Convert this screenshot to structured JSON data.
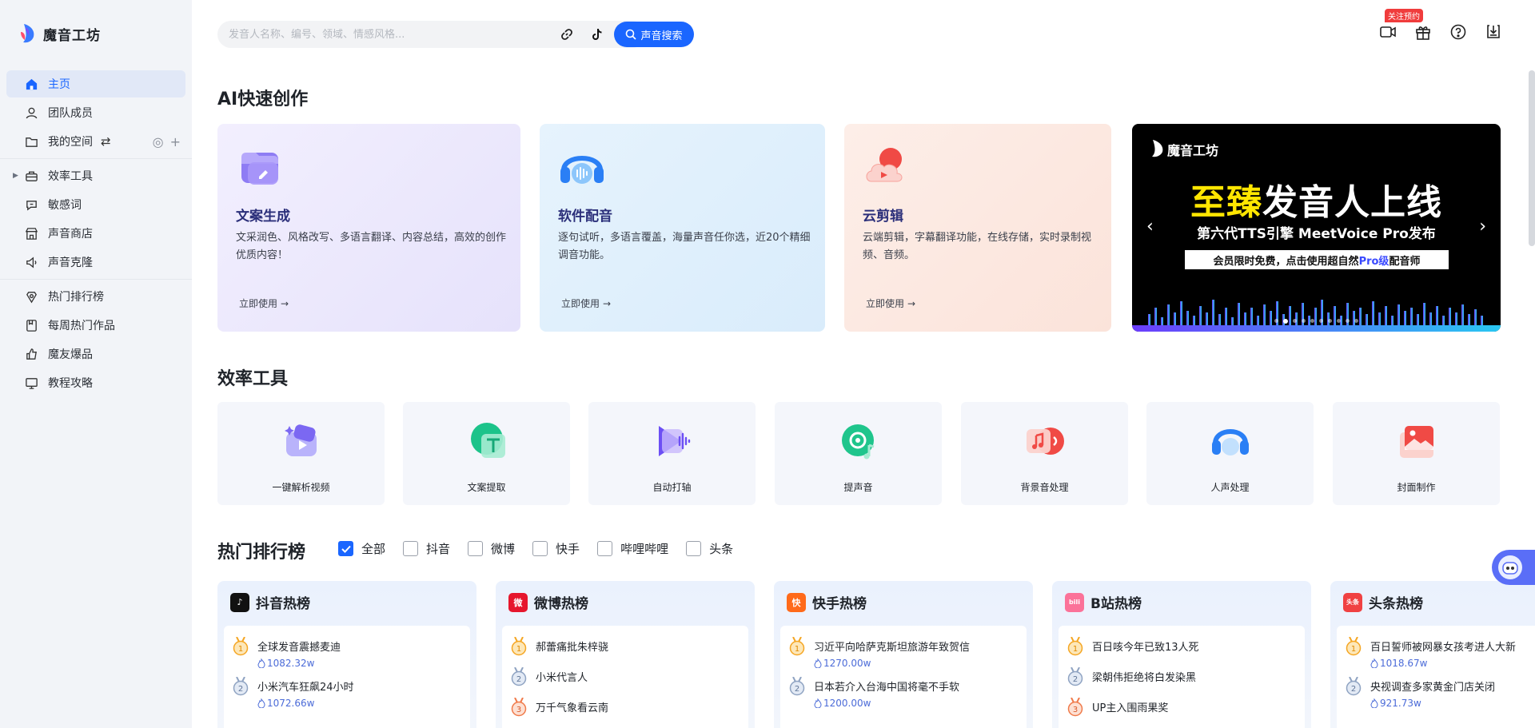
{
  "brand": {
    "name": "魔音工坊"
  },
  "sidebar": {
    "items": [
      {
        "label": "主页",
        "icon": "home-icon",
        "active": true
      },
      {
        "label": "团队成员",
        "icon": "user-icon"
      },
      {
        "label": "我的空间",
        "icon": "folder-icon"
      },
      {
        "label": "效率工具",
        "icon": "toolbox-icon"
      },
      {
        "label": "敏感词",
        "icon": "sensitive-icon"
      },
      {
        "label": "声音商店",
        "icon": "store-icon"
      },
      {
        "label": "声音克隆",
        "icon": "clone-icon"
      },
      {
        "label": "热门排行榜",
        "icon": "rank-icon"
      },
      {
        "label": "每周热门作品",
        "icon": "weekly-icon"
      },
      {
        "label": "魔友爆品",
        "icon": "thumbs-up-icon"
      },
      {
        "label": "教程攻略",
        "icon": "monitor-icon"
      }
    ],
    "swap_glyph": "⇄"
  },
  "search": {
    "placeholder": "发音人名称、编号、领域、情感风格...",
    "button_label": "声音搜索"
  },
  "topbar": {
    "badge": "关注预约"
  },
  "ai_section": {
    "title": "AI快速创作",
    "cards": [
      {
        "title": "文案生成",
        "desc": "文采润色、风格改写、多语言翻译、内容总结，高效的创作优质内容！",
        "action": "立即使用"
      },
      {
        "title": "软件配音",
        "desc": "逐句试听，多语言覆盖，海量声音任你选，近20个精细调音功能。",
        "action": "立即使用"
      },
      {
        "title": "云剪辑",
        "desc": "云端剪辑，字幕翻译功能，在线存储，实时录制视频、音频。",
        "action": "立即使用"
      }
    ],
    "banner": {
      "brand": "魔音工坊",
      "headline_highlight": "至臻",
      "headline_rest": "发音人上线",
      "subline": "第六代TTS引擎 MeetVoice Pro发布",
      "pill_pre": "会员限时免费，点击使用超自然",
      "pill_pro": "Pro级",
      "pill_post": "配音师"
    }
  },
  "tools_section": {
    "title": "效率工具",
    "items": [
      {
        "label": "一键解析视频"
      },
      {
        "label": "文案提取"
      },
      {
        "label": "自动打轴"
      },
      {
        "label": "提声音"
      },
      {
        "label": "背景音处理"
      },
      {
        "label": "人声处理"
      },
      {
        "label": "封面制作"
      }
    ]
  },
  "rank_section": {
    "title": "热门排行榜",
    "filters": [
      {
        "label": "全部",
        "checked": true
      },
      {
        "label": "抖音",
        "checked": false
      },
      {
        "label": "微博",
        "checked": false
      },
      {
        "label": "快手",
        "checked": false
      },
      {
        "label": "哔哩哔哩",
        "checked": false
      },
      {
        "label": "头条",
        "checked": false
      }
    ],
    "boards": [
      {
        "title": "抖音热榜",
        "logo_color": "#111111",
        "logo_glyph": "♪",
        "items": [
          {
            "rank": "1",
            "text": "全球发音震撼麦迪",
            "value": "1082.32w"
          },
          {
            "rank": "2",
            "text": "小米汽车狂飙24小时",
            "value": "1072.66w"
          }
        ]
      },
      {
        "title": "微博热榜",
        "logo_color": "#e6162d",
        "logo_glyph": "微",
        "items": [
          {
            "rank": "1",
            "text": "郝蕾痛批朱梓骁",
            "value": ""
          },
          {
            "rank": "2",
            "text": "小米代言人",
            "value": ""
          },
          {
            "rank": "3",
            "text": "万千气象看云南",
            "value": ""
          }
        ]
      },
      {
        "title": "快手热榜",
        "logo_color": "#ff6a1a",
        "logo_glyph": "快",
        "items": [
          {
            "rank": "1",
            "text": "习近平向哈萨克斯坦旅游年致贺信",
            "value": "1270.00w"
          },
          {
            "rank": "2",
            "text": "日本若介入台海中国将毫不手软",
            "value": "1200.00w"
          }
        ]
      },
      {
        "title": "B站热榜",
        "logo_color": "#fb7299",
        "logo_glyph": "bili",
        "items": [
          {
            "rank": "1",
            "text": "百日咳今年已致13人死",
            "value": ""
          },
          {
            "rank": "2",
            "text": "梁朝伟拒绝将白发染黑",
            "value": ""
          },
          {
            "rank": "3",
            "text": "UP主入围雨果奖",
            "value": ""
          }
        ]
      },
      {
        "title": "头条热榜",
        "logo_color": "#f04142",
        "logo_glyph": "头条",
        "items": [
          {
            "rank": "1",
            "text": "百日誓师被网暴女孩考进人大新",
            "value": "1018.67w"
          },
          {
            "rank": "2",
            "text": "央视调查多家黄金门店关闭",
            "value": "921.73w"
          }
        ]
      }
    ]
  },
  "colors": {
    "accent": "#1a66ff",
    "sidebar_bg": "#f2f4f8"
  }
}
